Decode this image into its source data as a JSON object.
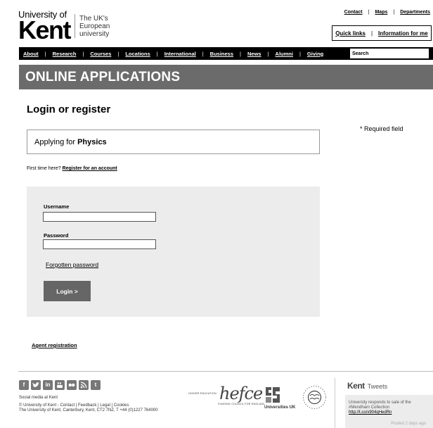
{
  "logo": {
    "university_of": "University of",
    "kent": "Kent",
    "tagline_1": "The UK's",
    "tagline_2": "European",
    "tagline_3": "university"
  },
  "toplinks": {
    "contact": "Contact",
    "maps": "Maps",
    "departments": "Departments",
    "separator": "|"
  },
  "quick": {
    "quick_links": "Quick links",
    "info_for_me": "Information for me",
    "separator": "|"
  },
  "nav": {
    "items": [
      "About",
      "Research",
      "Courses",
      "Locations",
      "International",
      "Business",
      "News",
      "Alumni",
      "Giving"
    ],
    "separator": "|",
    "search_placeholder": "Search"
  },
  "banner": {
    "title": "ONLINE APPLICATIONS"
  },
  "page": {
    "title": "Login or register",
    "required_note": "* Required field",
    "applying_prefix": "Applying for",
    "applying_subject": "Physics",
    "first_time_text": "First time here?",
    "register_link": "Register for an account"
  },
  "login": {
    "username_label": "Username",
    "password_label": "Password",
    "forgot_link": "Forgotten password",
    "login_button": "Login >"
  },
  "agent_link": "Agent registration",
  "footer": {
    "social_label": "Social media at Kent",
    "copyright_line1": "© University of Kent - Contact | Feedback | Legal | Cookies",
    "copyright_line2": "The University of Kent, Canterbury, Kent, CT2 7NZ, T +44 (0)1227 764000",
    "hefce_small": "HIGHER EDUCATION",
    "hefce_logo": "hefce",
    "hefce_small2": "FUNDING COUNCIL    FOR ENGLAND",
    "uuk_label": "Universities UK",
    "tweets_kent": "Kent",
    "tweets_label": "Tweets",
    "tweet_line1": "University responds to sale of the",
    "tweet_line2": "#Mendham Collection",
    "tweet_link": "http://t.co/x904qHedRn",
    "tweet_time": "Posted 2 days ago"
  },
  "icons": [
    "facebook-icon",
    "twitter-icon",
    "linkedin-icon",
    "youtube-icon",
    "flickr-icon",
    "rss-icon",
    "tumblr-icon"
  ],
  "colors": {
    "nav_bg": "#000000",
    "banner_bg": "#6b6b6b",
    "panel_bg": "#ececec",
    "button_bg": "#666666"
  }
}
